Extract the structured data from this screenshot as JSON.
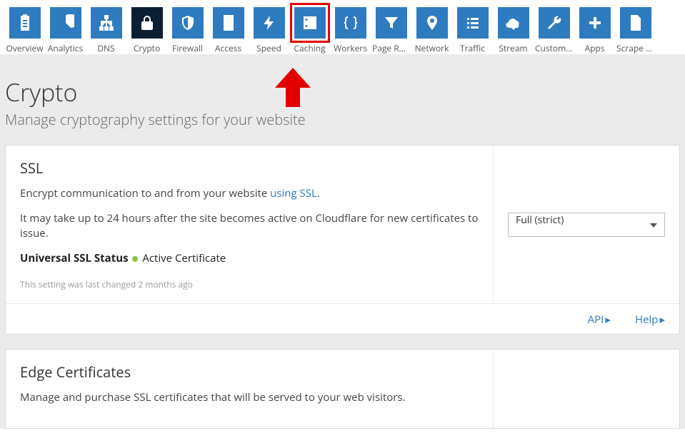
{
  "nav": [
    {
      "label": "Overview",
      "icon": "clipboard"
    },
    {
      "label": "Analytics",
      "icon": "pie"
    },
    {
      "label": "DNS",
      "icon": "sitemap"
    },
    {
      "label": "Crypto",
      "icon": "lock",
      "active": true
    },
    {
      "label": "Firewall",
      "icon": "shield"
    },
    {
      "label": "Access",
      "icon": "door"
    },
    {
      "label": "Speed",
      "icon": "bolt"
    },
    {
      "label": "Caching",
      "icon": "drive",
      "highlighted": true
    },
    {
      "label": "Workers",
      "icon": "braces"
    },
    {
      "label": "Page Rules",
      "icon": "funnel"
    },
    {
      "label": "Network",
      "icon": "marker"
    },
    {
      "label": "Traffic",
      "icon": "list"
    },
    {
      "label": "Stream",
      "icon": "cloud"
    },
    {
      "label": "Custom ...",
      "icon": "wrench"
    },
    {
      "label": "Apps",
      "icon": "plus"
    },
    {
      "label": "Scrape S...",
      "icon": "file"
    }
  ],
  "page": {
    "title": "Crypto",
    "subtitle": "Manage cryptography settings for your website"
  },
  "ssl_card": {
    "title": "SSL",
    "desc_prefix": "Encrypt communication to and from your website ",
    "desc_link": "using SSL",
    "desc_suffix": ".",
    "note": "It may take up to 24 hours after the site becomes active on Cloudflare for new certificates to issue.",
    "status_label": "Universal SSL Status",
    "status_value": "Active Certificate",
    "meta": "This setting was last changed 2 months ago",
    "select_value": "Full (strict)",
    "footer_api": "API",
    "footer_help": "Help"
  },
  "edge_card": {
    "title": "Edge Certificates",
    "desc": "Manage and purchase SSL certificates that will be served to your web visitors."
  }
}
